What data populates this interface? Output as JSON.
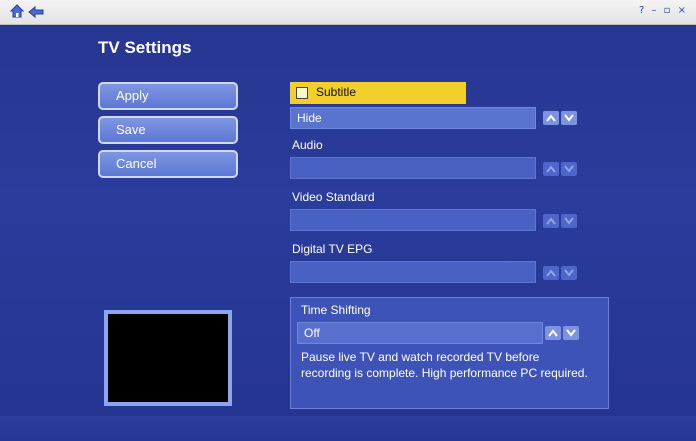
{
  "page_title": "TV Settings",
  "window_controls": "? – ▫ ×",
  "buttons": {
    "apply": "Apply",
    "save": "Save",
    "cancel": "Cancel"
  },
  "subtitle": {
    "label": "Subtitle",
    "checked": false,
    "value": "Hide"
  },
  "audio": {
    "label": "Audio",
    "value": ""
  },
  "video_standard": {
    "label": "Video Standard",
    "value": ""
  },
  "digital_tv_epg": {
    "label": "Digital TV EPG",
    "value": ""
  },
  "time_shifting": {
    "label": "Time Shifting",
    "value": "Off",
    "description": "Pause live TV and watch recorded TV before recording is complete. High performance PC required."
  },
  "icons": {
    "home": "home-icon",
    "back": "back-icon",
    "up": "chevron-up-icon",
    "down": "chevron-down-icon"
  },
  "colors": {
    "background": "#2a3c9c",
    "highlight": "#f3cf2b",
    "button": "#6c84db"
  }
}
